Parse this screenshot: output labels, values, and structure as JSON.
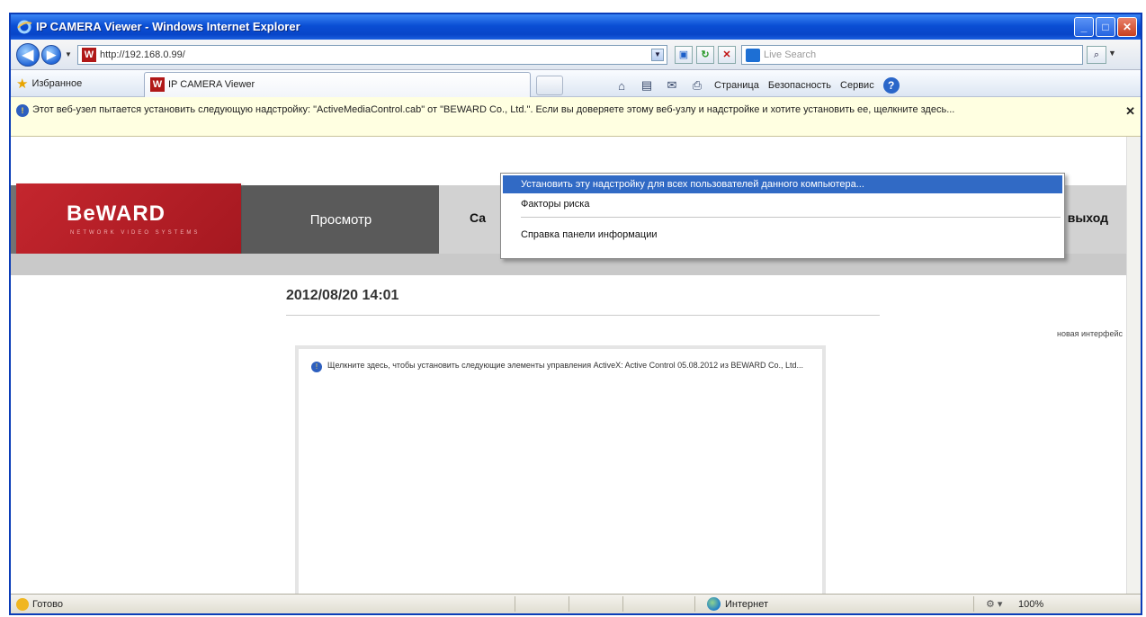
{
  "window": {
    "title": "IP CAMERA Viewer - Windows Internet Explorer",
    "minimize": "_",
    "maximize": "□",
    "close": "✕"
  },
  "addressbar": {
    "url": "http://192.168.0.99/",
    "search_placeholder": "Live Search"
  },
  "favorites_bar": {
    "favorites_label": "Избранное",
    "tab_title": "IP CAMERA Viewer"
  },
  "command_bar": {
    "page": "Страница",
    "safety": "Безопасность",
    "tools": "Сервис"
  },
  "infobar": {
    "message": "Этот веб-узел пытается установить следующую надстройку: \"ActiveMediaControl.cab\" от \"BEWARD Co., Ltd.\". Если вы доверяете этому веб-узлу и надстройке и хотите установить ее, щелкните здесь..."
  },
  "context_menu": {
    "items": [
      "Установить эту надстройку для всех пользователей данного компьютера...",
      "Факторы риска",
      "Справка панели информации"
    ]
  },
  "site": {
    "logo": "BeWARD",
    "logo_tagline": "NETWORK VIDEO SYSTEMS",
    "nav_view": "Просмотр",
    "nav_settings_partial": "Са",
    "nav_exit_partial": "выход",
    "datetime": "2012/08/20 14:01",
    "side_link": "новая интерфейс",
    "activex_message": "Щелкните здесь, чтобы установить следующие элементы управления ActiveX: Active Control 05.08.2012 из BEWARD Co., Ltd..."
  },
  "statusbar": {
    "status": "Готово",
    "zone": "Интернет",
    "zoom": "100%"
  }
}
